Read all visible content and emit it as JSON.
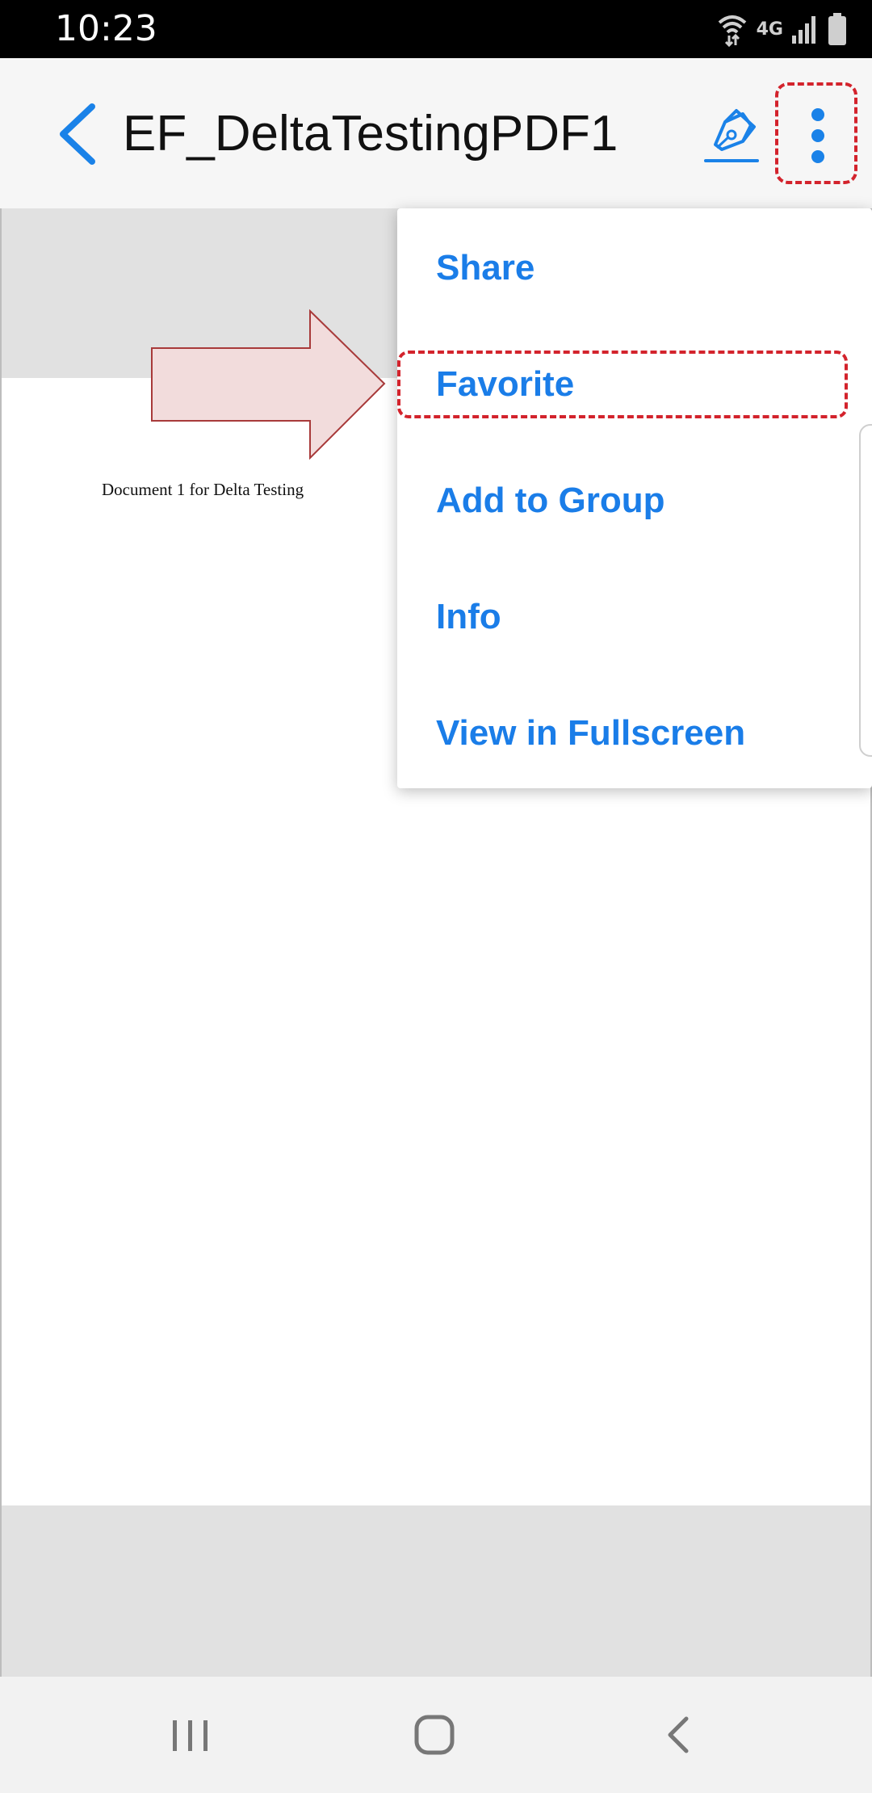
{
  "status_bar": {
    "time": "10:23",
    "network_label": "4G",
    "icons": [
      "wifi-icon",
      "signal-icon",
      "battery-icon"
    ]
  },
  "app_bar": {
    "title": "EF_DeltaTestingPDF1",
    "icons": [
      "back-arrow-icon",
      "pen-sign-icon",
      "more-vert-icon"
    ],
    "accent_color": "#1a82e8"
  },
  "document": {
    "text": "Document 1 for Delta Testing"
  },
  "menu": {
    "items": [
      {
        "label": "Share"
      },
      {
        "label": "Favorite"
      },
      {
        "label": "Add to Group"
      },
      {
        "label": "Info"
      },
      {
        "label": "View in Fullscreen"
      }
    ],
    "label_color": "#1a7de8"
  },
  "annotation": {
    "highlight_color": "#d3232c",
    "arrow_fill": "#f2dcdc"
  },
  "nav_bar": {
    "icons": [
      "recents-icon",
      "home-icon",
      "nav-back-icon"
    ]
  }
}
